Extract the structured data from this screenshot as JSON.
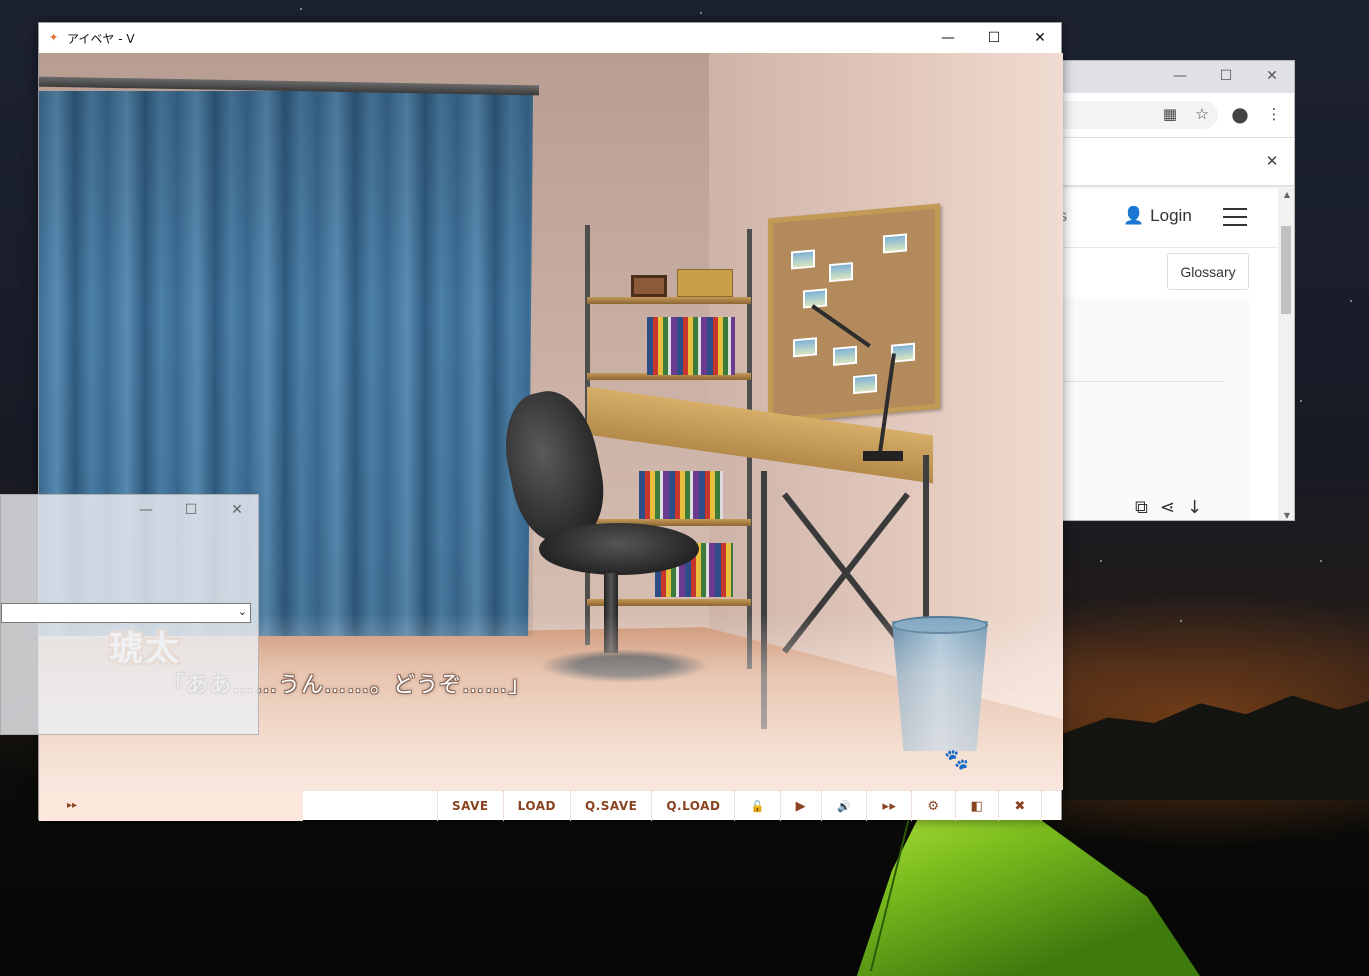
{
  "window_controls": {
    "minimize": "—",
    "maximize": "☐",
    "close": "✕"
  },
  "game": {
    "title": "アイベヤ - V",
    "speaker_name": "琥太",
    "dialogue_text": "「ああ……うん……。どうぞ……」",
    "menu": {
      "skip_mini": "▸▸",
      "save": "SAVE",
      "load": "LOAD",
      "qsave": "Q.SAVE",
      "qload": "Q.LOAD",
      "lock": "🔓",
      "auto": "▶",
      "voice": "🔊",
      "skip": "▸▸",
      "config": "⚙",
      "log": "◧",
      "close": "✖"
    }
  },
  "browser": {
    "login_label": "Login",
    "glossary_label": "Glossary",
    "partial_text": "s"
  },
  "colors": {
    "accent": "#8a4320",
    "menubar_left": "#fbe7dc",
    "curtain": "#3e6f96"
  }
}
